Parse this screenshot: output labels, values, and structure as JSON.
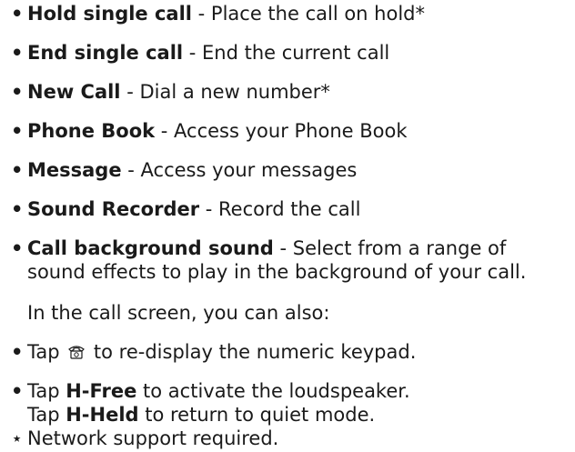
{
  "items": [
    {
      "bold": "Hold single call",
      "rest": " - Place the call on hold*"
    },
    {
      "bold": "End single call",
      "rest": " - End the current call"
    },
    {
      "bold": "New Call",
      "rest": " - Dial a new number*"
    },
    {
      "bold": "Phone Book",
      "rest": " - Access your Phone Book"
    },
    {
      "bold": "Message",
      "rest": " - Access your messages"
    },
    {
      "bold": "Sound Recorder",
      "rest": " - Record the call"
    },
    {
      "bold": "Call background sound",
      "rest": " - Select from a range of",
      "rest2": "sound effects to play in the background of your call."
    }
  ],
  "intro": "In the call screen, you can also:",
  "tap_keypad": {
    "pre": "Tap ",
    "icon": "phone-icon",
    "post": " to re-display the numeric keypad."
  },
  "tap_hfree": {
    "pre": "Tap ",
    "bold": "H-Free",
    "post": " to activate the loudspeaker."
  },
  "tap_hheld": {
    "pre": "Tap ",
    "bold": "H-Held",
    "post": " to return to quiet mode."
  },
  "footnote_marker": "⋆",
  "footnote": "Network support required.",
  "bullet_char": "•"
}
